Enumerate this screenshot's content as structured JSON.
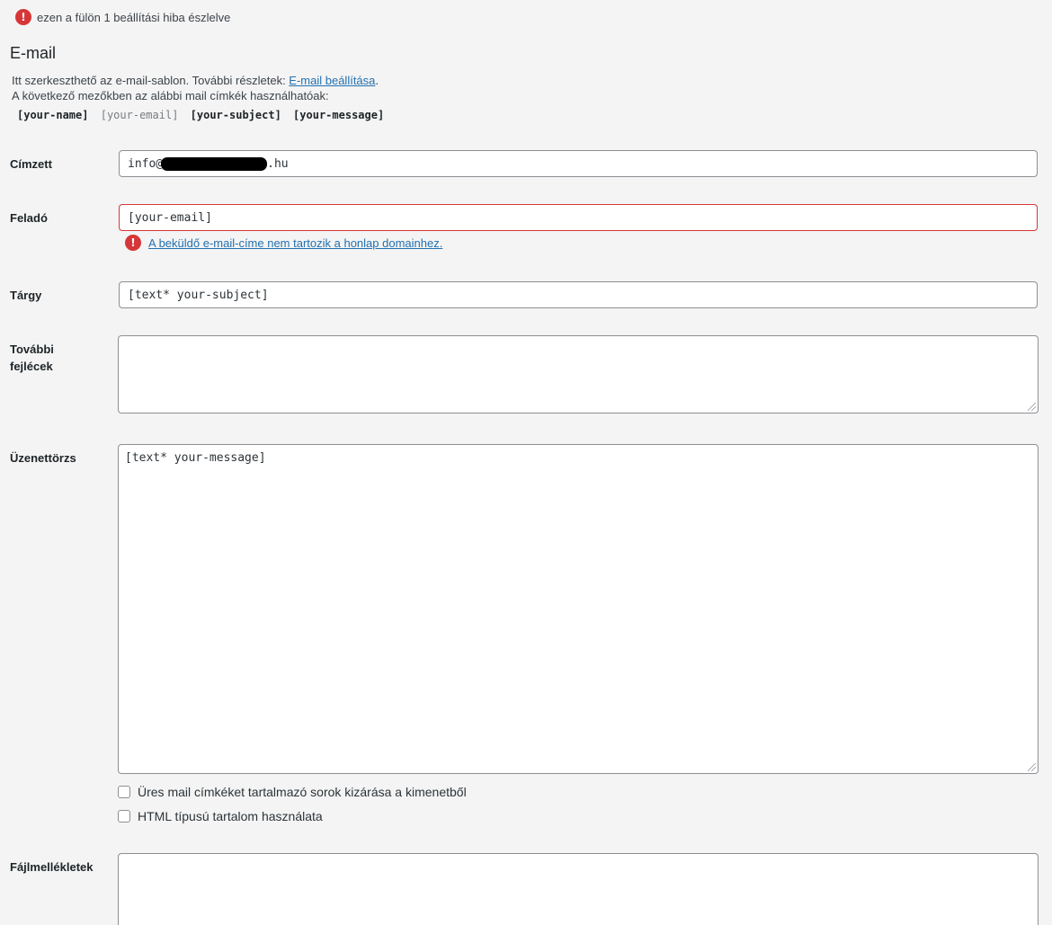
{
  "tab_error": {
    "text": "ezen a fülön 1 beállítási hiba észlelve",
    "icon": "error-icon"
  },
  "section": {
    "title": "E-mail"
  },
  "intro": {
    "line1_prefix": "Itt szerkeszthető az e-mail-sablon. További részletek: ",
    "line1_link": "E-mail beállítása",
    "line1_suffix": ".",
    "line2": "A következő mezőkben az alábbi mail címkék használhatóak:"
  },
  "tags": [
    "[your-name]",
    "[your-email]",
    "[your-subject]",
    "[your-message]"
  ],
  "fields": {
    "recipient": {
      "label": "Címzett",
      "value_prefix": "info@",
      "value_suffix": ".hu"
    },
    "sender": {
      "label": "Feladó",
      "value": "[your-email]",
      "error": "A beküldő e-mail-címe nem tartozik a honlap domainhez."
    },
    "subject": {
      "label": "Tárgy",
      "value": "[text* your-subject]"
    },
    "headers": {
      "label_line1": "További",
      "label_line2": "fejlécek",
      "value": ""
    },
    "body": {
      "label": "Üzenettörzs",
      "value": "[text* your-message]"
    },
    "attachments": {
      "label": "Fájlmellékletek",
      "value": ""
    }
  },
  "options": {
    "exclude_blank": {
      "label": "Üres mail címkéket tartalmazó sorok kizárása a kimenetből",
      "checked": false
    },
    "use_html": {
      "label": "HTML típusú tartalom használata",
      "checked": false
    }
  },
  "colors": {
    "error": "#d63638",
    "link": "#2271b1"
  }
}
